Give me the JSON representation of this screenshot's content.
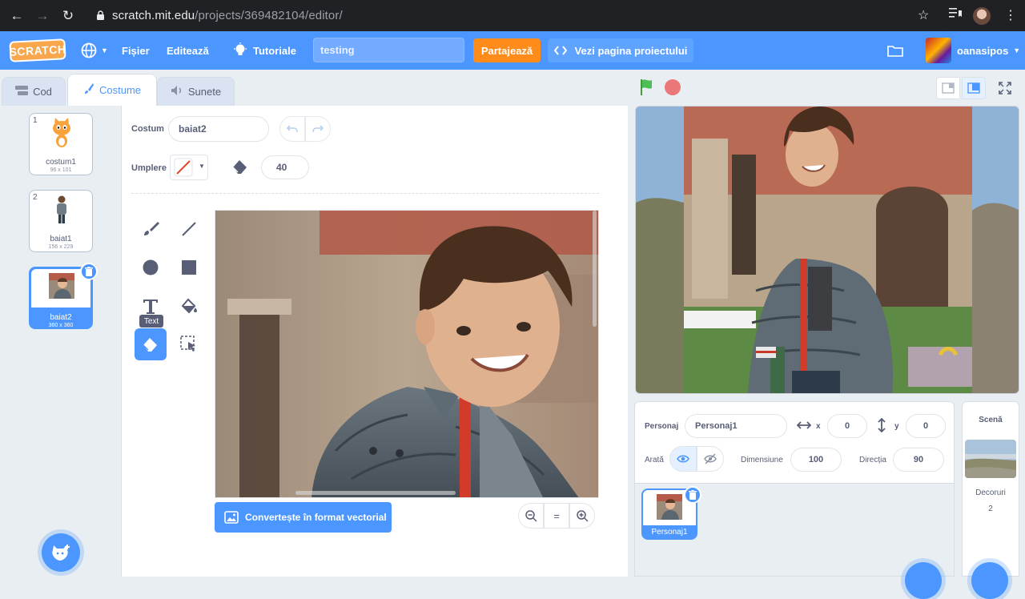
{
  "browser": {
    "url_host": "scratch.mit.edu",
    "url_path": "/projects/369482104/editor/"
  },
  "menubar": {
    "logo": "SCRATCH",
    "file": "Fișier",
    "edit": "Editează",
    "tutorials": "Tutoriale",
    "project_title": "testing",
    "share": "Partajează",
    "see_project_page": "Vezi pagina proiectului",
    "username": "oanasipos"
  },
  "tabs": {
    "code": "Cod",
    "costumes": "Costume",
    "sounds": "Sunete"
  },
  "costumes": [
    {
      "num": "1",
      "name": "costum1",
      "dims": "96 x 101"
    },
    {
      "num": "2",
      "name": "baiat1",
      "dims": "156 x 229"
    },
    {
      "num": "3",
      "name": "baiat2",
      "dims": "360 x 360"
    }
  ],
  "editor": {
    "costume_label": "Costum",
    "costume_name": "baiat2",
    "fill_label": "Umplere",
    "brush_size": "40",
    "tooltip": "Text",
    "convert_button": "Convertește în format vectorial",
    "zoom_reset": "="
  },
  "sprite_info": {
    "sprite_label": "Personaj",
    "sprite_name": "Personaj1",
    "x_label": "x",
    "x_value": "0",
    "y_label": "y",
    "y_value": "0",
    "show_label": "Arată",
    "size_label": "Dimensiune",
    "size_value": "100",
    "direction_label": "Direcția",
    "direction_value": "90"
  },
  "sprites": [
    {
      "name": "Personaj1"
    }
  ],
  "scene": {
    "title": "Scenă",
    "backdrops_label": "Decoruri",
    "backdrops_count": "2"
  },
  "colors": {
    "accent": "#4c97ff",
    "share": "#ff8c1a",
    "stop": "#ec5959",
    "flag": "#4cbf56"
  }
}
